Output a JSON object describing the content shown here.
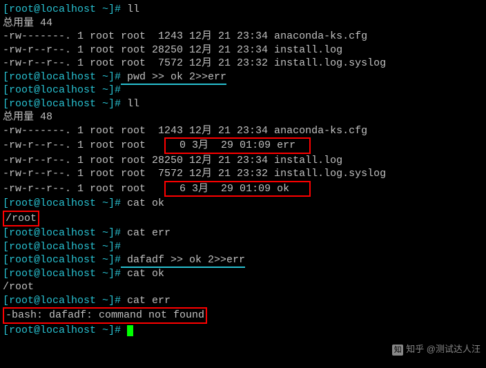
{
  "lines": {
    "l1_prompt": "[root@localhost ~]#",
    "l1_cmd": " ll",
    "l2": "总用量 44",
    "l3": "-rw-------. 1 root root  1243 12月 21 23:34 anaconda-ks.cfg",
    "l4": "-rw-r--r--. 1 root root 28250 12月 21 23:34 install.log",
    "l5": "-rw-r--r--. 1 root root  7572 12月 21 23:32 install.log.syslog",
    "l6_prompt": "[root@localhost ~]#",
    "l6_cmd": " pwd >> ok 2>>err",
    "l7_prompt": "[root@localhost ~]#",
    "l8_prompt": "[root@localhost ~]#",
    "l8_cmd": " ll",
    "l9": "总用量 48",
    "l10": "-rw-------. 1 root root  1243 12月 21 23:34 anaconda-ks.cfg",
    "l11a": "-rw-r--r--. 1 root root   ",
    "l11b": "  0 3月  29 01:09 err  ",
    "l12": "-rw-r--r--. 1 root root 28250 12月 21 23:34 install.log",
    "l13": "-rw-r--r--. 1 root root  7572 12月 21 23:32 install.log.syslog",
    "l14a": "-rw-r--r--. 1 root root   ",
    "l14b": "  6 3月  29 01:09 ok   ",
    "l15_prompt": "[root@localhost ~]#",
    "l15_cmd": " cat ok",
    "l16": "/root",
    "l17_prompt": "[root@localhost ~]#",
    "l17_cmd": " cat err",
    "l18_prompt": "[root@localhost ~]#",
    "l19_prompt": "[root@localhost ~]#",
    "l19_cmd": " dafadf >> ok 2>>err",
    "l20_prompt": "[root@localhost ~]#",
    "l20_cmd": " cat ok",
    "l21": "/root",
    "l22_prompt": "[root@localhost ~]#",
    "l22_cmd": " cat err",
    "l23": "-bash: dafadf: command not found",
    "l24_prompt": "[root@localhost ~]#",
    "l24_cmd": " "
  },
  "watermark": {
    "icon": "知",
    "text": "知乎 @测试达人汪"
  }
}
